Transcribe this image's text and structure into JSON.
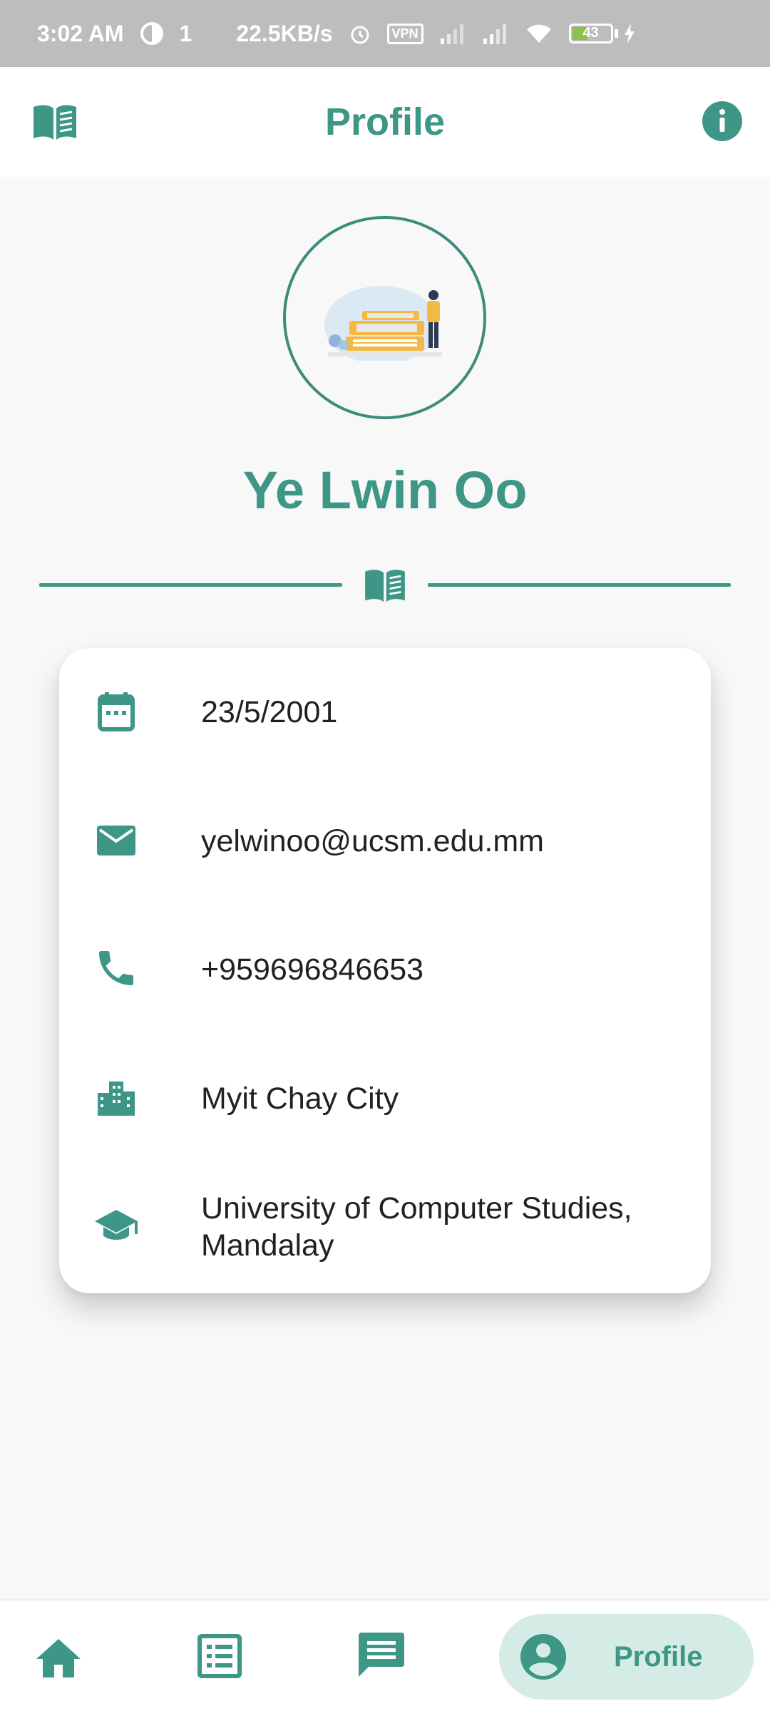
{
  "status_bar": {
    "time": "3:02 AM",
    "network_speed": "22.5KB/s",
    "vpn_label": "VPN",
    "battery_level": "43",
    "small_indicator": "1"
  },
  "app_bar": {
    "title": "Profile",
    "left_icon": "book-icon",
    "right_icon": "info-icon"
  },
  "profile": {
    "name": "Ye Lwin Oo",
    "avatar": "reading-books-illustration"
  },
  "details": [
    {
      "icon": "calendar-icon",
      "value": "23/5/2001"
    },
    {
      "icon": "email-icon",
      "value": "yelwinoo@ucsm.edu.mm"
    },
    {
      "icon": "phone-icon",
      "value": "+959696846653"
    },
    {
      "icon": "city-icon",
      "value": "Myit Chay City"
    },
    {
      "icon": "school-icon",
      "value": "University of Computer Studies, Mandalay"
    }
  ],
  "bottom_nav": {
    "items": [
      {
        "icon": "home-icon"
      },
      {
        "icon": "list-icon"
      },
      {
        "icon": "chat-icon"
      },
      {
        "icon": "account-icon",
        "label": "Profile",
        "active": true
      }
    ]
  },
  "colors": {
    "accent": "#3d9686",
    "active_nav_bg": "#d5ebe6",
    "status_bar_bg": "#bdbdbd"
  }
}
